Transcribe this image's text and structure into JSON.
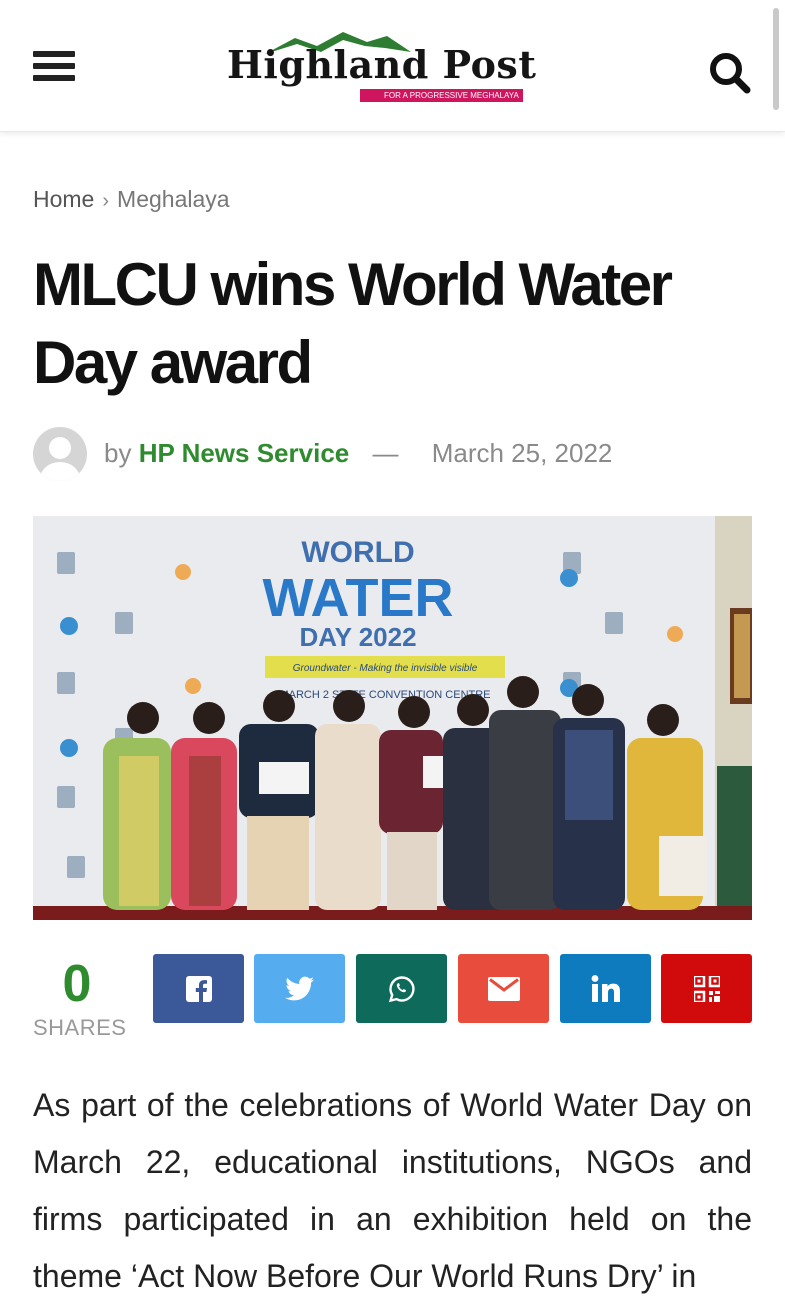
{
  "header": {
    "logo": {
      "name": "Highland Post",
      "tagline": "FOR A PROGRESSIVE MEGHALAYA"
    }
  },
  "breadcrumb": {
    "home": "Home",
    "separator": "›",
    "current": "Meghalaya"
  },
  "article": {
    "title": "MLCU wins World Water Day award",
    "by": "by",
    "author": "HP News Service",
    "dash": "—",
    "date": "March 25, 2022",
    "image": {
      "banner_line1": "WORLD",
      "banner_line2": "WATER",
      "banner_line3": "DAY 2022",
      "banner_theme": "Groundwater - Making the invisible visible",
      "banner_venue": "MARCH 2 STATE CONVENTION CENTRE"
    },
    "body": "As part of the celebrations of World Water Day on March 22, educational institutions, NGOs and firms participated in an exhibition held on the theme ‘Act Now Before Our World Runs Dry’ in"
  },
  "share": {
    "count": "0",
    "label": "SHARES",
    "buttons": [
      {
        "icon": "facebook-icon",
        "color": "#3b5998"
      },
      {
        "icon": "twitter-icon",
        "color": "#55acee"
      },
      {
        "icon": "whatsapp-icon",
        "color": "#0e6b5c"
      },
      {
        "icon": "email-icon",
        "color": "#e74c3c"
      },
      {
        "icon": "linkedin-icon",
        "color": "#0e7bbf"
      },
      {
        "icon": "qr-code-icon",
        "color": "#d10b0b"
      }
    ]
  },
  "colors": {
    "accent_green": "#2e8b2e",
    "brand_pink": "#d0155f"
  }
}
